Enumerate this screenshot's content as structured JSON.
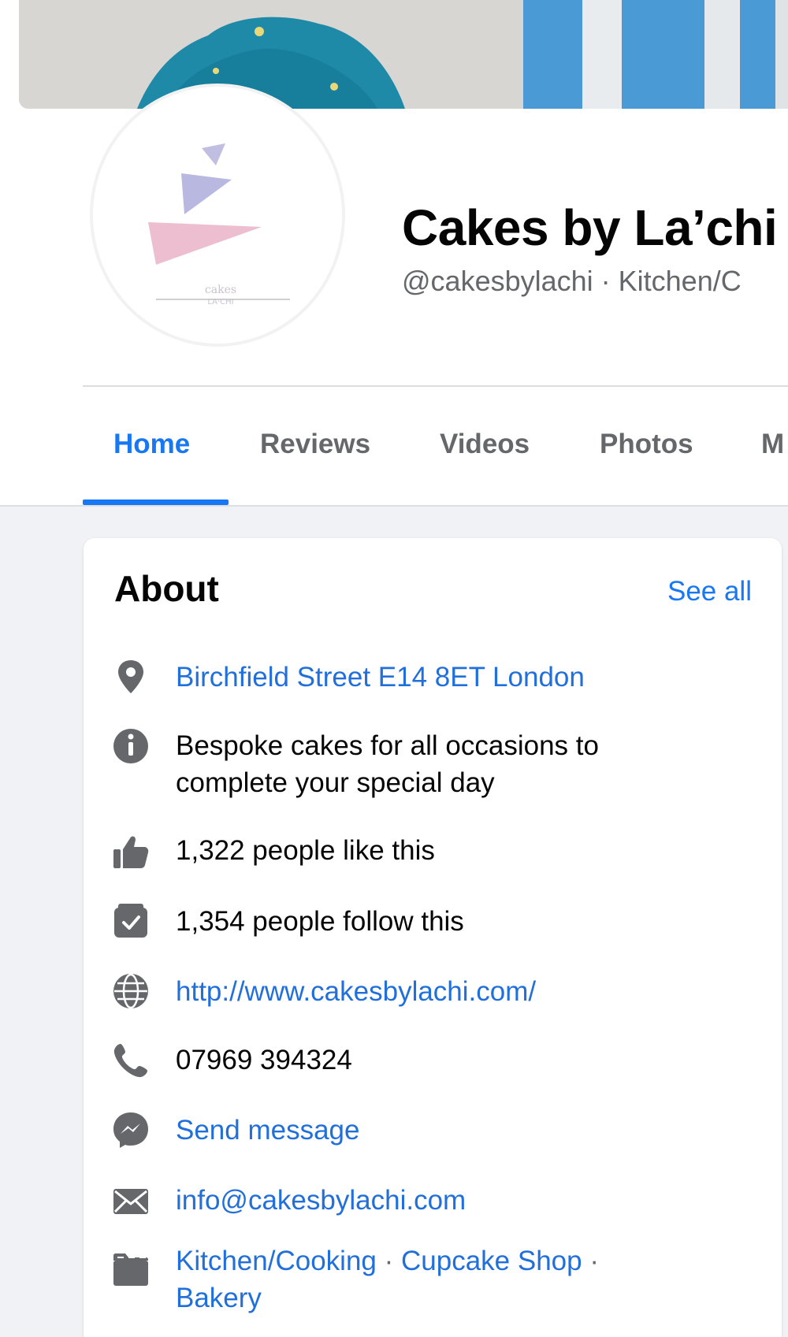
{
  "page": {
    "name": "Cakes by La’chi",
    "handle_line": "@cakesbylachi · Kitchen/C"
  },
  "tabs": [
    {
      "label": "Home",
      "active": true
    },
    {
      "label": "Reviews",
      "active": false
    },
    {
      "label": "Videos",
      "active": false
    },
    {
      "label": "Photos",
      "active": false
    },
    {
      "label": "M",
      "active": false
    }
  ],
  "about": {
    "title": "About",
    "see_all": "See all",
    "address": "Birchfield Street E14 8ET London",
    "description_line1": "Bespoke cakes for all occasions to",
    "description_line2": "complete your special day",
    "likes": "1,322 people like this",
    "follows": "1,354 people follow this",
    "website": "http://www.cakesbylachi.com/",
    "phone": "07969 394324",
    "message": "Send message",
    "email": "info@cakesbylachi.com",
    "categories": {
      "cat1": "Kitchen/Cooking",
      "sep1": " · ",
      "cat2": "Cupcake Shop",
      "sep2": " ·",
      "cat3": "Bakery"
    }
  },
  "colors": {
    "accent": "#1877f2",
    "link": "#216fdb",
    "icon": "#65676b",
    "background": "#f0f2f5"
  },
  "icons": {
    "address": "map-pin-icon",
    "description": "info-icon",
    "likes": "thumbs-up-icon",
    "follows": "follow-check-icon",
    "website": "globe-icon",
    "phone": "phone-icon",
    "message": "messenger-icon",
    "email": "envelope-icon",
    "category": "category-folder-icon"
  }
}
